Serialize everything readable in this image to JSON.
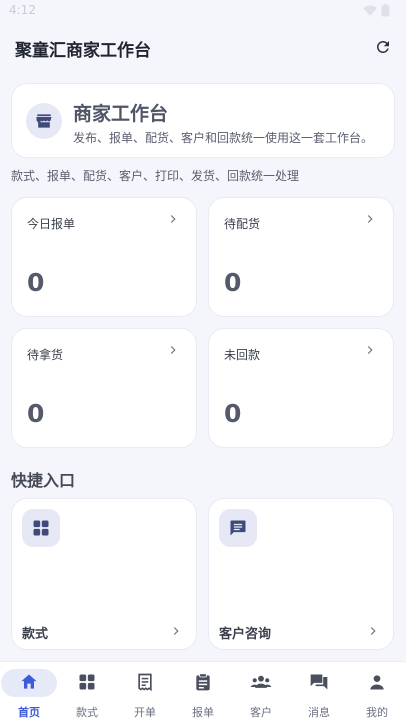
{
  "status_bar": {
    "time": "4:12"
  },
  "app_bar": {
    "title": "聚童汇商家工作台"
  },
  "hero": {
    "title": "商家工作台",
    "subtitle": "发布、报单、配货、客户和回款统一使用这一套工作台。"
  },
  "summary": "款式、报单、配货、客户、打印、发货、回款统一处理",
  "stats": [
    {
      "label": "今日报单",
      "value": "0"
    },
    {
      "label": "待配货",
      "value": "0"
    },
    {
      "label": "待拿货",
      "value": "0"
    },
    {
      "label": "未回款",
      "value": "0"
    }
  ],
  "quick_entry": {
    "title": "快捷入口",
    "items": [
      {
        "label": "款式",
        "icon": "grid-icon"
      },
      {
        "label": "客户咨询",
        "icon": "chat-icon"
      }
    ]
  },
  "bottom_nav": {
    "items": [
      {
        "label": "首页",
        "icon": "home-icon",
        "active": true
      },
      {
        "label": "款式",
        "icon": "grid-icon"
      },
      {
        "label": "开单",
        "icon": "receipt-icon"
      },
      {
        "label": "报单",
        "icon": "clipboard-icon"
      },
      {
        "label": "客户",
        "icon": "group-icon"
      },
      {
        "label": "消息",
        "icon": "forum-icon"
      },
      {
        "label": "我的",
        "icon": "person-icon"
      }
    ]
  },
  "colors": {
    "accent": "#3d5bd9",
    "icon_primary": "#3f4a7a",
    "background": "#f5f6fb"
  }
}
